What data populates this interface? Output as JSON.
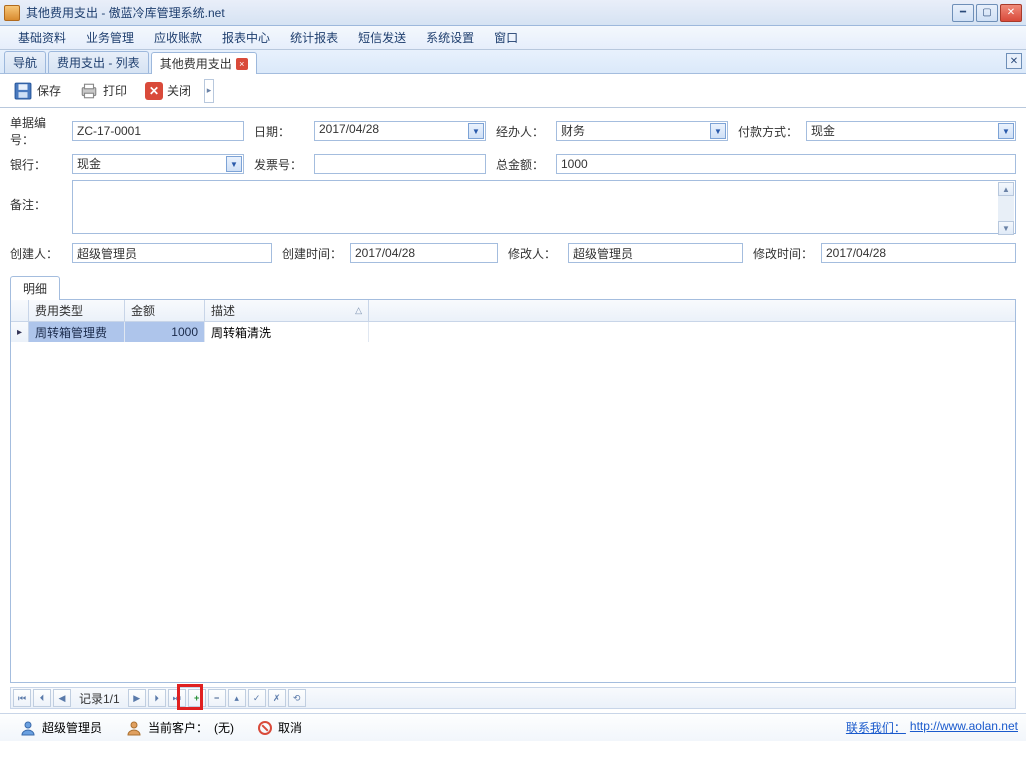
{
  "titlebar": {
    "text": "其他费用支出 - 傲蓝冷库管理系统.net"
  },
  "menubar": [
    "基础资料",
    "业务管理",
    "应收账款",
    "报表中心",
    "统计报表",
    "短信发送",
    "系统设置",
    "窗口"
  ],
  "tabs": {
    "nav": "导航",
    "list": "费用支出 - 列表",
    "active": "其他费用支出"
  },
  "toolbar": {
    "save": "保存",
    "print": "打印",
    "close": "关闭"
  },
  "form": {
    "order_no_label": "单据编号：",
    "order_no": "ZC-17-0001",
    "date_label": "日期：",
    "date": "2017/04/28",
    "handler_label": "经办人：",
    "handler": "财务",
    "pay_method_label": "付款方式：",
    "pay_method": "现金",
    "bank_label": "银行：",
    "bank": "现金",
    "invoice_label": "发票号：",
    "invoice": "",
    "total_label": "总金额：",
    "total": "1000",
    "remark_label": "备注：",
    "remark": "",
    "creator_label": "创建人：",
    "creator": "超级管理员",
    "create_time_label": "创建时间：",
    "create_time": "2017/04/28",
    "modifier_label": "修改人：",
    "modifier": "超级管理员",
    "modify_time_label": "修改时间：",
    "modify_time": "2017/04/28"
  },
  "detail": {
    "tab": "明细",
    "columns": {
      "type": "费用类型",
      "amount": "金额",
      "desc": "描述"
    },
    "rows": [
      {
        "type": "周转箱管理费",
        "amount": "1000",
        "desc": "周转箱清洗"
      }
    ]
  },
  "navigator": {
    "label": "记录1/1"
  },
  "statusbar": {
    "user": "超级管理员",
    "client_label": "当前客户：",
    "client_value": "(无)",
    "cancel": "取消",
    "contact_label": "联系我们：",
    "contact_url": "http://www.aolan.net"
  }
}
